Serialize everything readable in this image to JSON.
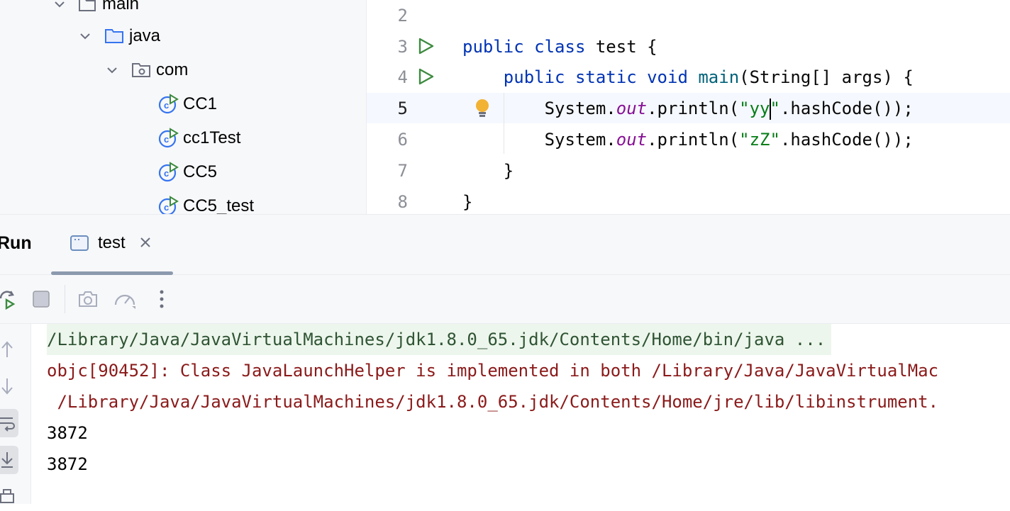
{
  "project_tree": {
    "items": [
      {
        "label": "main",
        "kind": "module-folder",
        "expanded": true
      },
      {
        "label": "java",
        "kind": "source-folder",
        "expanded": true
      },
      {
        "label": "com",
        "kind": "package",
        "expanded": true
      },
      {
        "label": "CC1",
        "kind": "class-runnable"
      },
      {
        "label": "cc1Test",
        "kind": "class-runnable"
      },
      {
        "label": "CC5",
        "kind": "class-runnable"
      },
      {
        "label": "CC5_test",
        "kind": "class-runnable"
      }
    ]
  },
  "editor": {
    "line_numbers": [
      "2",
      "3",
      "4",
      "5",
      "6",
      "7",
      "8"
    ],
    "current_line": "5",
    "code": {
      "l3_public": "public",
      "l3_class": "class",
      "l3_name": " test {",
      "l4_public": "public",
      "l4_static": "static",
      "l4_void": "void",
      "l4_main": "main",
      "l4_rest": "(String[] args) {",
      "l5_system": "System.",
      "l5_out": "out",
      "l5_println": ".println(",
      "l5_str_a": "\"yy",
      "l5_str_b": "\"",
      "l5_rest": ".hashCode());",
      "l6_system": "System.",
      "l6_out": "out",
      "l6_println": ".println(",
      "l6_str": "\"zZ\"",
      "l6_rest": ".hashCode());",
      "l7_brace": "}",
      "l8_brace": "}"
    }
  },
  "run_panel": {
    "title": "Run",
    "tab_label": "test",
    "console_lines": [
      {
        "type": "command",
        "text": "/Library/Java/JavaVirtualMachines/jdk1.8.0_65.jdk/Contents/Home/bin/java ..."
      },
      {
        "type": "error",
        "text": "objc[90452]: Class JavaLaunchHelper is implemented in both /Library/Java/JavaVirtualMac"
      },
      {
        "type": "error",
        "text": " /Library/Java/JavaVirtualMachines/jdk1.8.0_65.jdk/Contents/Home/jre/lib/libinstrument."
      },
      {
        "type": "output",
        "text": "3872"
      },
      {
        "type": "output",
        "text": "3872"
      }
    ]
  },
  "colors": {
    "keyword": "#0033b3",
    "method": "#00627a",
    "field": "#871094",
    "string": "#067d17",
    "error": "#8b1a1a",
    "run_green": "#3d8b40"
  }
}
